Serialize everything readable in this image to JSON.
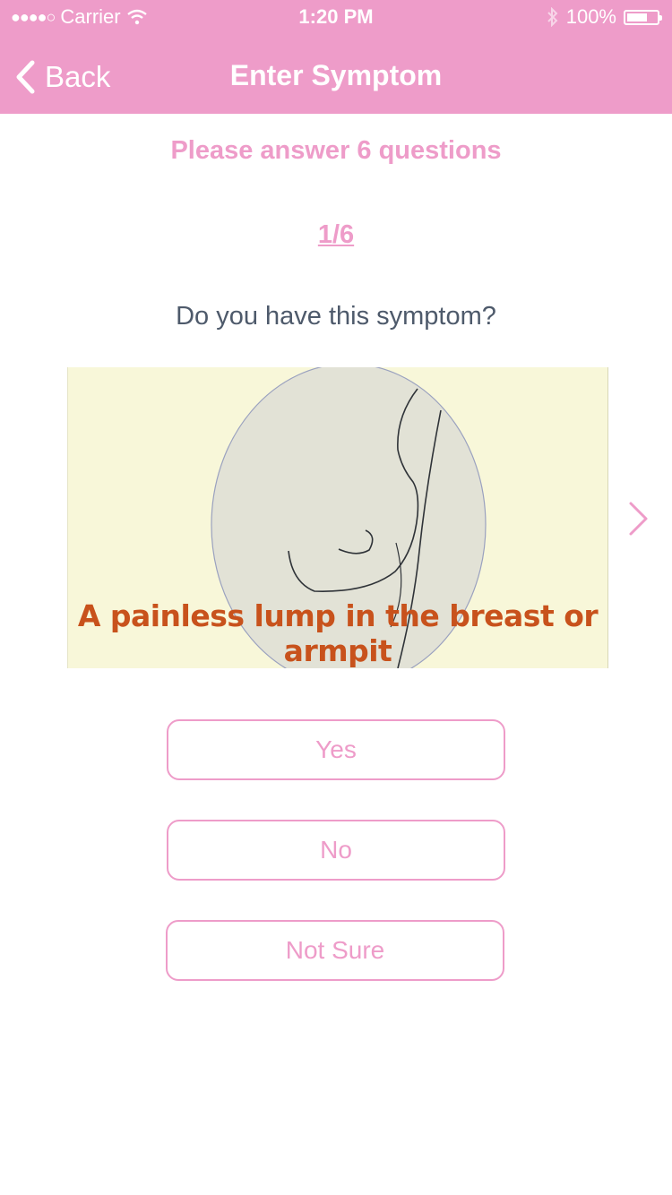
{
  "status_bar": {
    "carrier": "Carrier",
    "time": "1:20 PM",
    "battery": "100%"
  },
  "nav": {
    "back_label": "Back",
    "title": "Enter Symptom"
  },
  "survey": {
    "prompt": "Please answer 6 questions",
    "progress": "1/6",
    "question": "Do you have this symptom?",
    "image_caption": "A painless lump in the breast or armpit"
  },
  "answers": [
    {
      "label": "Yes"
    },
    {
      "label": "No"
    },
    {
      "label": "Not Sure"
    }
  ],
  "colors": {
    "accent": "#ee9cc9",
    "question_text": "#4e5a6b",
    "card_background": "#f8f7d9",
    "caption_text": "#c8521c"
  }
}
